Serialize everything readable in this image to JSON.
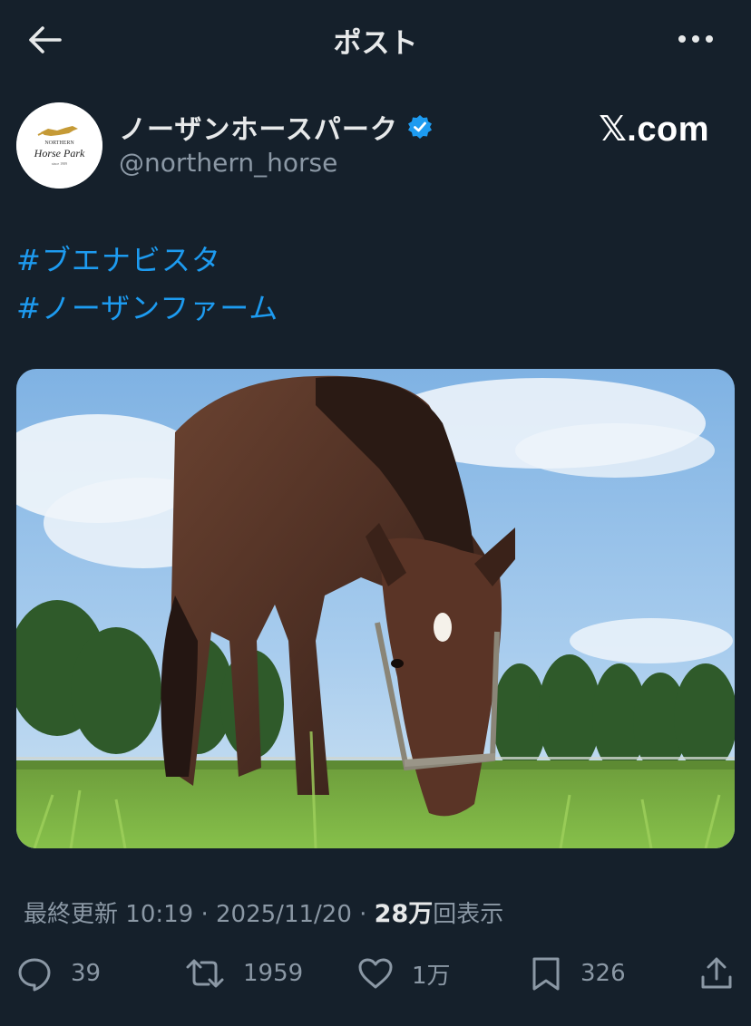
{
  "header": {
    "title": "ポスト"
  },
  "author": {
    "name": "ノーザンホースパーク",
    "handle": "@northern_horse",
    "avatar": {
      "line1": "NORTHERN",
      "line2": "Horse Park",
      "line3": "since 1989"
    }
  },
  "source_badge": "𝕏.com",
  "post": {
    "hashtags": [
      "#ブエナビスタ",
      "#ノーザンファーム"
    ]
  },
  "meta": {
    "updated_label": "最終更新",
    "time": "10:19",
    "date": "2025/11/20",
    "separator": "·",
    "views": "28万",
    "views_label": "回表示"
  },
  "actions": {
    "replies": "39",
    "reposts": "1959",
    "likes": "1万",
    "bookmarks": "326"
  },
  "colors": {
    "background": "#15202b",
    "accent": "#1d9bf0",
    "muted": "#8b98a5",
    "verified": "#1d9bf0"
  }
}
